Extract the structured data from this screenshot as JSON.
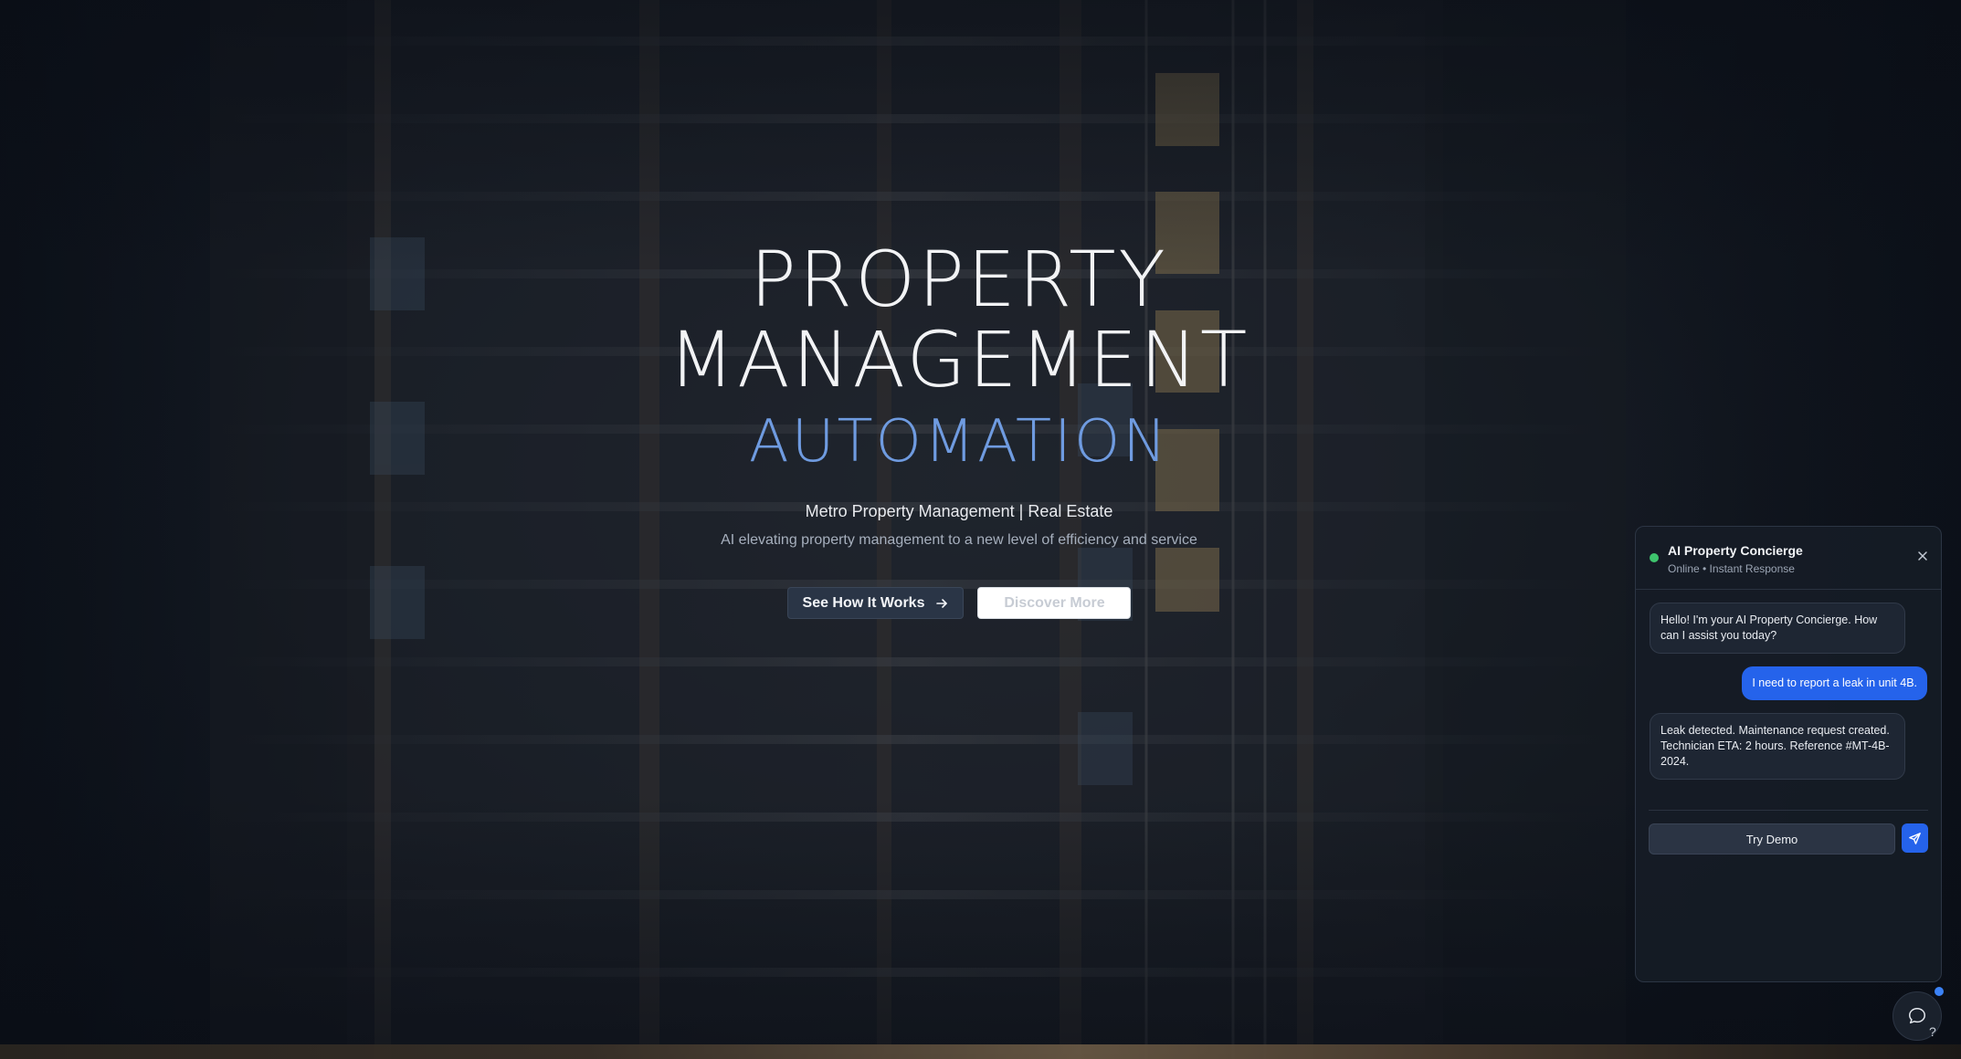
{
  "hero": {
    "title_line1": "PROPERTY",
    "title_line2": "MANAGEMENT",
    "title_accent": "AUTOMATION",
    "subtitle": "Metro Property Management | Real Estate",
    "description": "AI elevating property management to a new level of efficiency and service",
    "primary_button": "See How It Works",
    "secondary_button": "Discover More",
    "accent_color": "#6f9be0"
  },
  "chat": {
    "title": "AI Property Concierge",
    "status": "Online • Instant Response",
    "status_color": "#3ec46d",
    "messages": [
      {
        "role": "bot",
        "text": "Hello! I'm your AI Property Concierge. How can I assist you today?"
      },
      {
        "role": "user",
        "text": "I need to report a leak in unit 4B."
      },
      {
        "role": "bot",
        "text": "Leak detected. Maintenance request created. Technician ETA: 2 hours. Reference #MT-4B-2024."
      }
    ],
    "input_placeholder": "Try Demo",
    "send_color": "#2563eb"
  },
  "launcher": {
    "icon": "chat-bubble-icon",
    "help_text": "?"
  }
}
